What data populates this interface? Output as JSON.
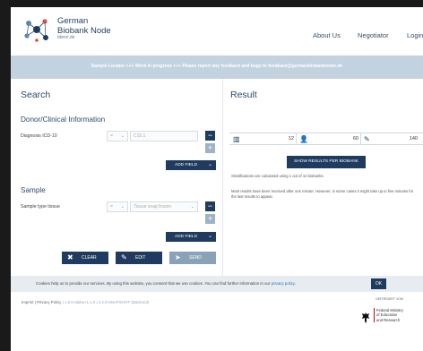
{
  "header": {
    "brand_line1": "German",
    "brand_line2": "Biobank Node",
    "brand_line3": "bbmri.de",
    "nav": [
      "About Us",
      "Negotiator",
      "Login"
    ]
  },
  "banner": {
    "text": "Sample Locator +++ Work in progress +++ Please report any feedback and bugs to feedback@germanbiobanknode.de"
  },
  "search": {
    "title": "Search",
    "donor_heading": "Donor/Clinical Information",
    "diagnosis_label": "Diagnosis ICD-10",
    "diagnosis_operator": "=",
    "diagnosis_value": "C15.1",
    "sample_heading": "Sample",
    "sample_type_label": "Sample type tissue",
    "sample_type_operator": "=",
    "sample_type_placeholder": "Tissue snap frozen",
    "add_field_label": "ADD FIELD",
    "clear_label": "CLEAR",
    "edit_label": "EDIT",
    "send_label": "SEND"
  },
  "result": {
    "title": "Result",
    "stats": {
      "biobanks": "12",
      "donors": "60",
      "samples": "140"
    },
    "show_results_label": "SHOW RESULTS PER BIOBANK",
    "stats_note": "Stratifications are calculated using 1 out of 12 biobanks.",
    "results_note": "Most results have been received after one minute. However, in some cases it might take up to five minutes for the last results to appear."
  },
  "cookie": {
    "text": "Cookies help us to provide our services. By using this website, you consent that we use cookies. You can find further information in our",
    "link": "privacy policy",
    "ok_label": "OK"
  },
  "footer": {
    "imprint": "Imprint",
    "privacy": "Privacy Policy",
    "version": "| 1.5.0-alpha+1.1.0 | 2.2.8-SNAPSHOT (Backend)",
    "sponsor_caption": "GEFÖRDERT VOM",
    "ministry_l1": "Federal Ministry",
    "ministry_l2": "of Education",
    "ministry_l3": "and Research"
  },
  "colors": {
    "primary": "#1f3b5f",
    "banner": "#c3d2df",
    "cookie_bg": "#e7ecf1"
  }
}
